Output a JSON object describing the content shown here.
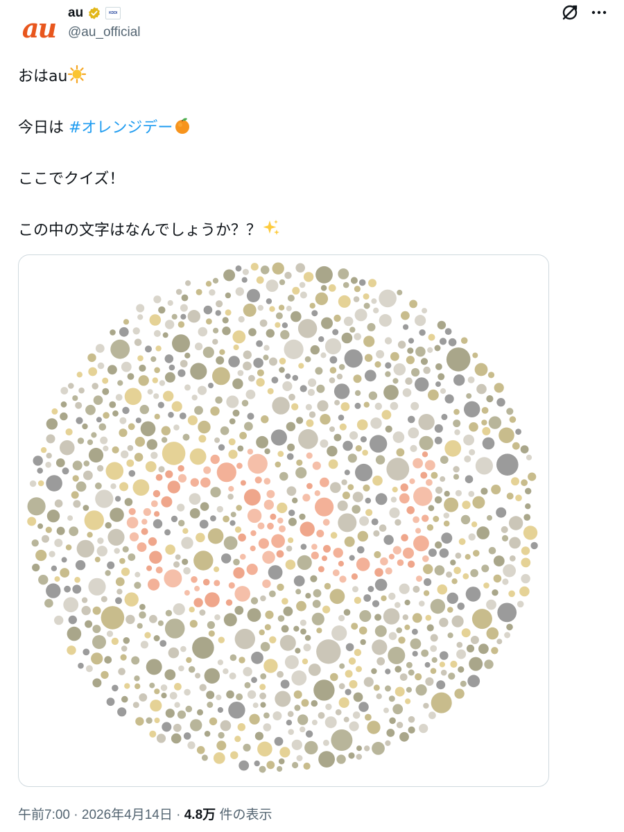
{
  "account": {
    "avatar_text": "au",
    "display_name": "au",
    "handle": "@au_official",
    "affiliate_badge_text": "KDDI",
    "verified_badge": "verified-gold-icon",
    "colors": {
      "brand": "#e8561d",
      "verified": "#e2b719"
    }
  },
  "header_icons": [
    "grok-icon",
    "more-icon"
  ],
  "tweet": {
    "line1": "おはau",
    "line1_emoji": "sun-icon",
    "line2_prefix": "今日は ",
    "line2_hashtag": "#オレンジデー",
    "line2_emoji": "orange-icon",
    "line3": "ここでクイズ！",
    "line4": "この中の文字はなんでしょうか？？",
    "line4_emoji": "sparkles-icon",
    "colors": {
      "hashtag": "#1d9bf0",
      "text": "#0f1419"
    }
  },
  "media": {
    "type": "color-vision-test-plate",
    "hidden_text": "au",
    "colors": {
      "figure": [
        "#f3b198",
        "#f5bfa9",
        "#efa68b"
      ],
      "background": [
        "#9b9b9b",
        "#b8b59a",
        "#d9d5cb",
        "#e5d296",
        "#cbc6b8",
        "#a9a68a",
        "#c8bc8c"
      ]
    }
  },
  "meta": {
    "time": "午前7:00",
    "date": "2026年4月14日",
    "views_count": "4.8万",
    "views_label": "件の表示"
  }
}
